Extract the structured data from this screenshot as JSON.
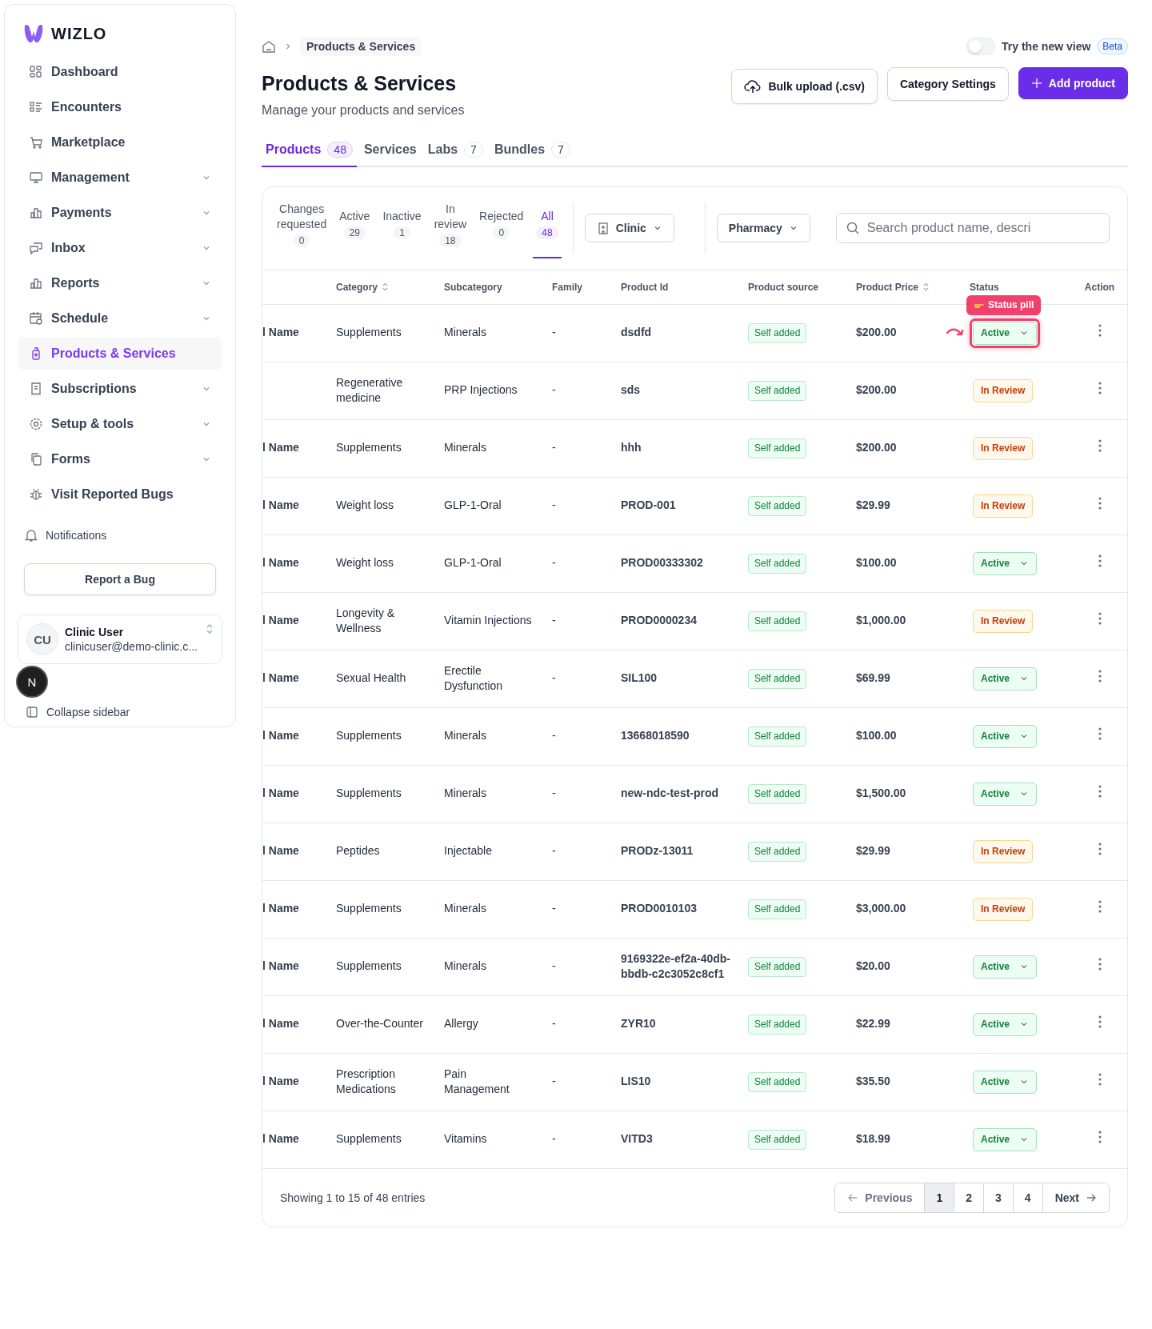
{
  "brand": {
    "name": "WIZLO"
  },
  "sidebar": {
    "items": [
      {
        "label": "Dashboard",
        "expandable": false,
        "selected": false
      },
      {
        "label": "Encounters",
        "expandable": false,
        "selected": false
      },
      {
        "label": "Marketplace",
        "expandable": false,
        "selected": false
      },
      {
        "label": "Management",
        "expandable": true,
        "selected": false
      },
      {
        "label": "Payments",
        "expandable": true,
        "selected": false
      },
      {
        "label": "Inbox",
        "expandable": true,
        "selected": false
      },
      {
        "label": "Reports",
        "expandable": true,
        "selected": false
      },
      {
        "label": "Schedule",
        "expandable": true,
        "selected": false
      },
      {
        "label": "Products & Services",
        "expandable": false,
        "selected": true
      },
      {
        "label": "Subscriptions",
        "expandable": true,
        "selected": false
      },
      {
        "label": "Setup & tools",
        "expandable": true,
        "selected": false
      },
      {
        "label": "Forms",
        "expandable": true,
        "selected": false
      },
      {
        "label": "Visit Reported Bugs",
        "expandable": false,
        "selected": false
      }
    ],
    "notifications": "Notifications",
    "report_button": "Report a Bug",
    "user": {
      "initials": "CU",
      "name": "Clinic User",
      "email": "clinicuser@demo-clinic.c..."
    },
    "dev_badge": "N",
    "collapse": "Collapse sidebar"
  },
  "breadcrumb": {
    "current": "Products & Services"
  },
  "new_view": {
    "label": "Try the new view",
    "badge": "Beta",
    "on": false
  },
  "header": {
    "title": "Products & Services",
    "subtitle": "Manage your products and services"
  },
  "buttons": [
    {
      "label": "Bulk upload (.csv)",
      "kind": "upload"
    },
    {
      "label": "Category Settings",
      "kind": "plain"
    },
    {
      "label": "Add product",
      "kind": "primary"
    }
  ],
  "tabs": [
    {
      "label": "Products",
      "count": "48",
      "selected": true
    },
    {
      "label": "Services",
      "selected": false
    },
    {
      "label": "Labs",
      "count": "7",
      "selected": false
    },
    {
      "label": "Bundles",
      "count": "7",
      "selected": false
    }
  ],
  "status_filters": [
    {
      "label": "Changes requested",
      "count": "0",
      "selected": false
    },
    {
      "label": "Active",
      "count": "29",
      "selected": false
    },
    {
      "label": "Inactive",
      "count": "1",
      "selected": false
    },
    {
      "label": "In review",
      "count": "18",
      "selected": false
    },
    {
      "label": "Rejected",
      "count": "0",
      "selected": false
    },
    {
      "label": "All",
      "count": "48",
      "selected": true
    }
  ],
  "filters": [
    {
      "label": "Clinic",
      "icon": true
    },
    {
      "label": "Pharmacy",
      "icon": false
    }
  ],
  "search": {
    "placeholder": "Search product name, descri"
  },
  "table": {
    "columns": [
      {
        "sortable": false
      },
      {
        "label": "Category",
        "sortable": true
      },
      {
        "label": "Subcategory",
        "sortable": false
      },
      {
        "label": "Family",
        "sortable": false
      },
      {
        "label": "Product Id",
        "sortable": false
      },
      {
        "label": "Product source",
        "sortable": false
      },
      {
        "label": "Product Price",
        "sortable": true
      },
      {
        "label": "Status",
        "sortable": false
      },
      {
        "label": "Action",
        "sortable": false
      }
    ],
    "rows": [
      {
        "name": "l Name",
        "category": "Supplements",
        "subcategory": "Minerals",
        "family": "-",
        "id": "dsdfd",
        "source": "Self added",
        "price": "$200.00",
        "status": "Active",
        "kind": "active",
        "highlighted": true
      },
      {
        "name": "",
        "category": "Regenerative medicine",
        "subcategory": "PRP Injections",
        "family": "-",
        "id": "sds",
        "source": "Self added",
        "price": "$200.00",
        "status": "In Review",
        "kind": "review",
        "highlighted": false
      },
      {
        "name": "l Name",
        "category": "Supplements",
        "subcategory": "Minerals",
        "family": "-",
        "id": "hhh",
        "source": "Self added",
        "price": "$200.00",
        "status": "In Review",
        "kind": "review",
        "highlighted": false
      },
      {
        "name": "l Name",
        "category": "Weight loss",
        "subcategory": "GLP-1-Oral",
        "family": "-",
        "id": "PROD-001",
        "source": "Self added",
        "price": "$29.99",
        "status": "In Review",
        "kind": "review",
        "highlighted": false
      },
      {
        "name": "l Name",
        "category": "Weight loss",
        "subcategory": "GLP-1-Oral",
        "family": "-",
        "id": "PROD00333302",
        "source": "Self added",
        "price": "$100.00",
        "status": "Active",
        "kind": "active",
        "highlighted": false
      },
      {
        "name": "l Name",
        "category": "Longevity & Wellness",
        "subcategory": "Vitamin Injections",
        "family": "-",
        "id": "PROD0000234",
        "source": "Self added",
        "price": "$1,000.00",
        "status": "In Review",
        "kind": "review",
        "highlighted": false
      },
      {
        "name": "l Name",
        "category": "Sexual Health",
        "subcategory": "Erectile Dysfunction",
        "family": "-",
        "id": "SIL100",
        "source": "Self added",
        "price": "$69.99",
        "status": "Active",
        "kind": "active",
        "highlighted": false
      },
      {
        "name": "l Name",
        "category": "Supplements",
        "subcategory": "Minerals",
        "family": "-",
        "id": "13668018590",
        "source": "Self added",
        "price": "$100.00",
        "status": "Active",
        "kind": "active",
        "highlighted": false
      },
      {
        "name": "l Name",
        "category": "Supplements",
        "subcategory": "Minerals",
        "family": "-",
        "id": "new-ndc-test-prod",
        "source": "Self added",
        "price": "$1,500.00",
        "status": "Active",
        "kind": "active",
        "highlighted": false
      },
      {
        "name": "l Name",
        "category": "Peptides",
        "subcategory": "Injectable",
        "family": "-",
        "id": "PRODz-13011",
        "source": "Self added",
        "price": "$29.99",
        "status": "In Review",
        "kind": "review",
        "highlighted": false
      },
      {
        "name": "l Name",
        "category": "Supplements",
        "subcategory": "Minerals",
        "family": "-",
        "id": "PROD0010103",
        "source": "Self added",
        "price": "$3,000.00",
        "status": "In Review",
        "kind": "review",
        "highlighted": false
      },
      {
        "name": "l Name",
        "category": "Supplements",
        "subcategory": "Minerals",
        "family": "-",
        "id": "9169322e-ef2a-40db-bbdb-c2c3052c8cf1",
        "source": "Self added",
        "price": "$20.00",
        "status": "Active",
        "kind": "active",
        "highlighted": false
      },
      {
        "name": "l Name",
        "category": "Over-the-Counter",
        "subcategory": "Allergy",
        "family": "-",
        "id": "ZYR10",
        "source": "Self added",
        "price": "$22.99",
        "status": "Active",
        "kind": "active",
        "highlighted": false
      },
      {
        "name": "l Name",
        "category": "Prescription Medications",
        "subcategory": "Pain Management",
        "family": "-",
        "id": "LIS10",
        "source": "Self added",
        "price": "$35.50",
        "status": "Active",
        "kind": "active",
        "highlighted": false
      },
      {
        "name": "l Name",
        "category": "Supplements",
        "subcategory": "Vitamins",
        "family": "-",
        "id": "VITD3",
        "source": "Self added",
        "price": "$18.99",
        "status": "Active",
        "kind": "active",
        "highlighted": false
      }
    ]
  },
  "annotation": {
    "label": "Status pill"
  },
  "pagination": {
    "summary": "Showing 1 to 15 of 48 entries",
    "previous": "Previous",
    "next": "Next",
    "pages": [
      {
        "label": "1",
        "selected": true
      },
      {
        "label": "2",
        "selected": false
      },
      {
        "label": "3",
        "selected": false
      },
      {
        "label": "4",
        "selected": false
      }
    ]
  }
}
